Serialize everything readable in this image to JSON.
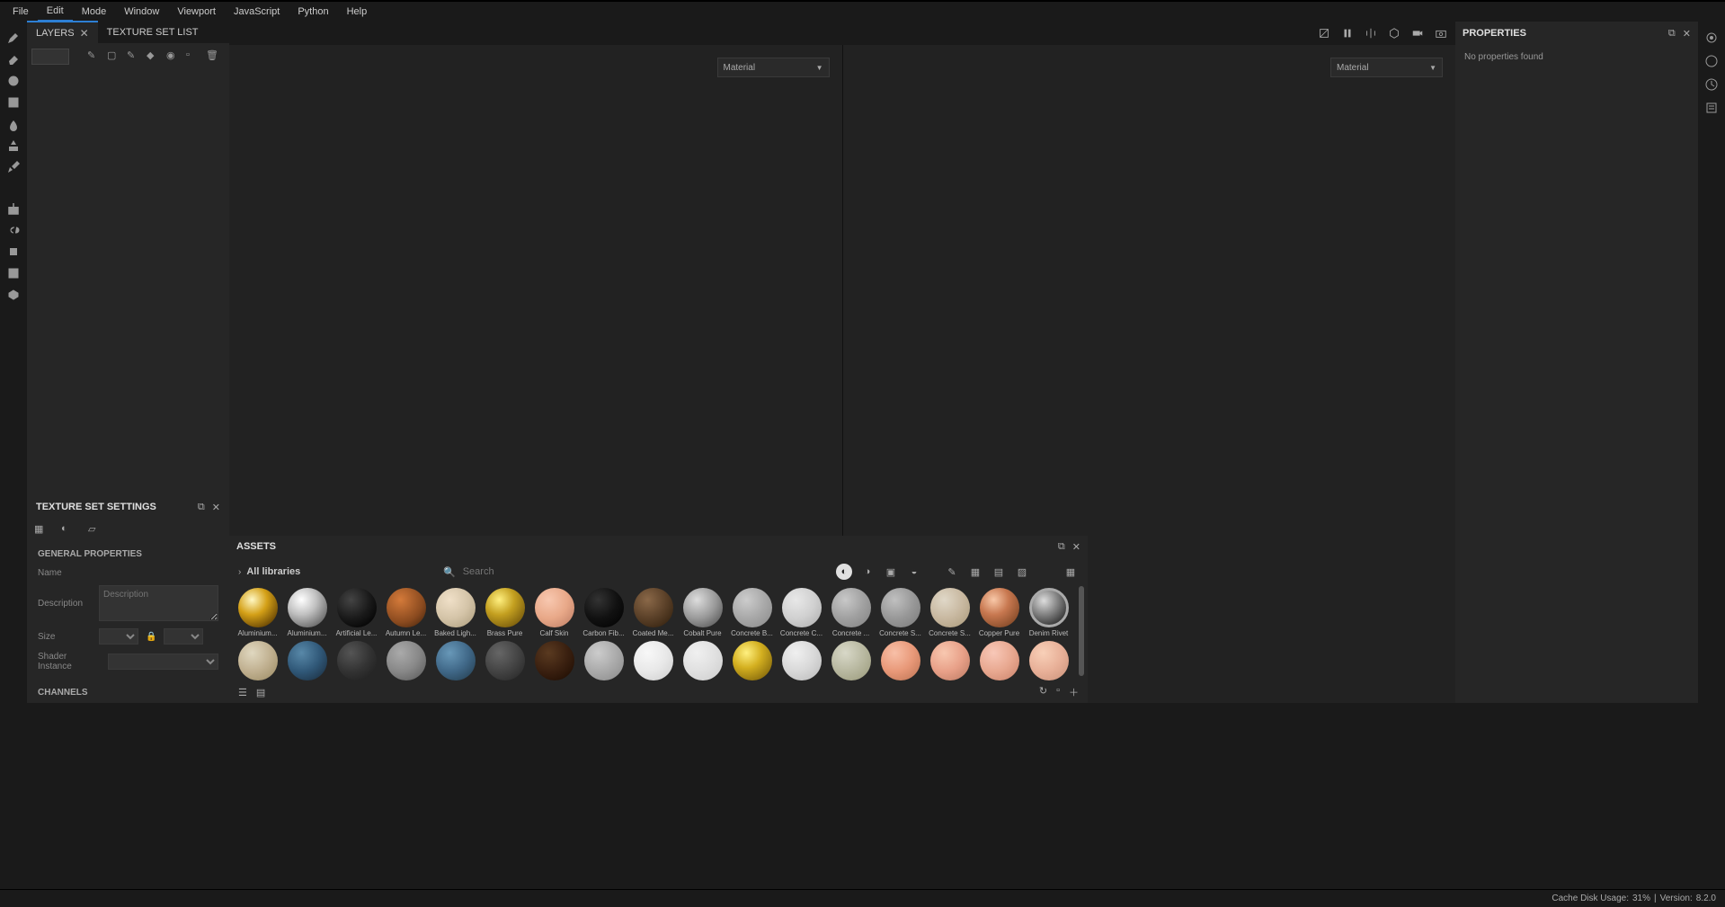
{
  "menu": [
    "File",
    "Edit",
    "Mode",
    "Window",
    "Viewport",
    "JavaScript",
    "Python",
    "Help"
  ],
  "tabs": {
    "layers": "LAYERS",
    "texture_set_list": "TEXTURE SET LIST"
  },
  "viewport": {
    "material_label": "Material"
  },
  "properties": {
    "title": "PROPERTIES",
    "empty": "No properties found"
  },
  "settings": {
    "title": "TEXTURE SET SETTINGS",
    "general": "GENERAL PROPERTIES",
    "name_label": "Name",
    "desc_label": "Description",
    "desc_placeholder": "Description",
    "size_label": "Size",
    "shader_label": "Shader Instance",
    "channels": "CHANNELS"
  },
  "assets": {
    "title": "ASSETS",
    "breadcrumb": "All libraries",
    "search_placeholder": "Search",
    "row1": [
      {
        "label": "Aluminium...",
        "cls": "sp-aluminium"
      },
      {
        "label": "Aluminium...",
        "cls": "sp-aluminium2"
      },
      {
        "label": "Artificial Le...",
        "cls": "sp-leather"
      },
      {
        "label": "Autumn Le...",
        "cls": "sp-autumn"
      },
      {
        "label": "Baked Ligh...",
        "cls": "sp-baked"
      },
      {
        "label": "Brass Pure",
        "cls": "sp-brass"
      },
      {
        "label": "Calf Skin",
        "cls": "sp-calf"
      },
      {
        "label": "Carbon Fib...",
        "cls": "sp-carbon"
      },
      {
        "label": "Coated Me...",
        "cls": "sp-coated"
      },
      {
        "label": "Cobalt Pure",
        "cls": "sp-cobalt"
      },
      {
        "label": "Concrete B...",
        "cls": "sp-concrete"
      },
      {
        "label": "Concrete C...",
        "cls": "sp-concrete2"
      },
      {
        "label": "Concrete ...",
        "cls": "sp-concrete3"
      },
      {
        "label": "Concrete S...",
        "cls": "sp-concrete4"
      },
      {
        "label": "Concrete S...",
        "cls": "sp-concrete5"
      },
      {
        "label": "Copper Pure",
        "cls": "sp-copper"
      },
      {
        "label": "Denim Rivet",
        "cls": "sp-denim"
      }
    ],
    "row2": [
      "sp-r2-1",
      "sp-r2-2",
      "sp-r2-3",
      "sp-r2-4",
      "sp-r2-5",
      "sp-r2-6",
      "sp-r2-7",
      "sp-r2-8",
      "sp-r2-9",
      "sp-r2-10",
      "sp-r2-11",
      "sp-r2-12",
      "sp-r2-13",
      "sp-r2-14",
      "sp-r2-15",
      "sp-r2-16",
      "sp-r2-17"
    ]
  },
  "status": {
    "cache_label": "Cache Disk Usage:",
    "cache_value": "31%",
    "sep": " | ",
    "version_label": "Version:",
    "version_value": "8.2.0"
  }
}
